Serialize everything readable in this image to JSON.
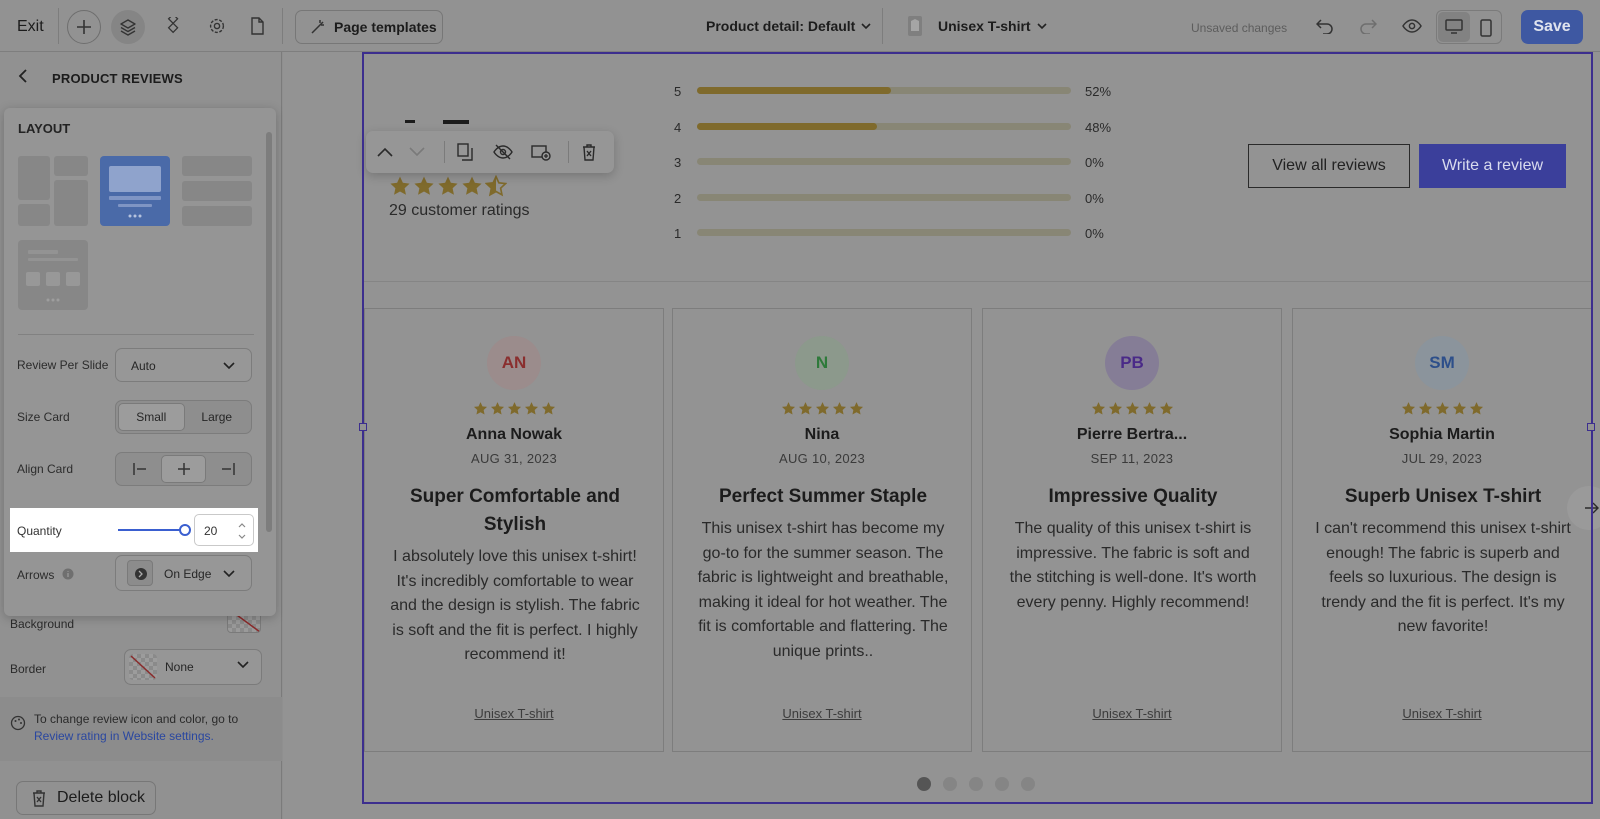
{
  "topbar": {
    "exit_label": "Exit",
    "templates_label": "Page templates",
    "page_label": "Product detail: Default",
    "product_label": "Unisex T-shirt",
    "unsaved_label": "Unsaved changes",
    "save_label": "Save"
  },
  "panel": {
    "title": "PRODUCT REVIEWS",
    "layout_label": "LAYOUT",
    "review_per_slide_label": "Review Per Slide",
    "review_per_slide_value": "Auto",
    "size_card_label": "Size Card",
    "size_options": [
      "Small",
      "Large"
    ],
    "size_selected": "Small",
    "align_card_label": "Align Card",
    "quantity_label": "Quantity",
    "quantity_value": "20",
    "arrows_label": "Arrows",
    "arrows_value": "On Edge",
    "background_label": "Background",
    "border_label": "Border",
    "border_value": "None",
    "info_text": "To change review icon and color, go to",
    "info_link": "Review rating in Website settings.",
    "delete_label": "Delete block"
  },
  "summary": {
    "ratings_text": "29 customer ratings",
    "average_stars": 4.5,
    "bars": [
      {
        "star": "5",
        "fraction": 0.52,
        "pct": "52%"
      },
      {
        "star": "4",
        "fraction": 0.48,
        "pct": "48%"
      },
      {
        "star": "3",
        "fraction": 0,
        "pct": "0%"
      },
      {
        "star": "2",
        "fraction": 0,
        "pct": "0%"
      },
      {
        "star": "1",
        "fraction": 0,
        "pct": "0%"
      }
    ],
    "view_all_label": "View all reviews",
    "write_label": "Write a review"
  },
  "reviews": [
    {
      "initials": "AN",
      "name": "Anna Nowak",
      "date": "AUG 31, 2023",
      "title": "Super Comfortable and Stylish",
      "body": "I absolutely love this unisex t-shirt! It's incredibly comfortable to wear and the design is stylish. The fabric is soft and the fit is perfect. I highly recommend it!",
      "product": "Unisex T-shirt",
      "stars": 5,
      "avatar_bg": "#9b8c8c",
      "avatar_fg": "#8a2e2e"
    },
    {
      "initials": "N",
      "name": "Nina",
      "date": "AUG 10, 2023",
      "title": "Perfect Summer Staple",
      "body": "This unisex t-shirt has become my go-to for the summer season. The fabric is lightweight and breathable, making it ideal for hot weather. The fit is comfortable and flattering. The unique prints..",
      "product": "Unisex T-shirt",
      "stars": 5,
      "avatar_bg": "#8c998c",
      "avatar_fg": "#2e7a3a"
    },
    {
      "initials": "PB",
      "name": "Pierre Bertra...",
      "date": "SEP 11, 2023",
      "title": "Impressive Quality",
      "body": "The quality of this unisex t-shirt is impressive. The fabric is soft and the stitching is well-done. It's worth every penny. Highly recommend!",
      "product": "Unisex T-shirt",
      "stars": 5,
      "avatar_bg": "#857d96",
      "avatar_fg": "#4a2a88"
    },
    {
      "initials": "SM",
      "name": "Sophia Martin",
      "date": "JUL 29, 2023",
      "title": "Superb Unisex T-shirt",
      "body": "I can't recommend this unisex t-shirt enough! The fabric is superb and feels so luxurious. The design is trendy and the fit is perfect. It's my new favorite!",
      "product": "Unisex T-shirt",
      "stars": 5,
      "avatar_bg": "#8b949c",
      "avatar_fg": "#2d4f8a"
    }
  ],
  "carousel": {
    "page_count": 5,
    "active_page": 1
  },
  "colors": {
    "accent": "#3a5fd0",
    "save_button": "#3e58a2",
    "write_button": "#3b3f9b",
    "star": "#7f6a2c",
    "selection": "#3c2e8e"
  }
}
